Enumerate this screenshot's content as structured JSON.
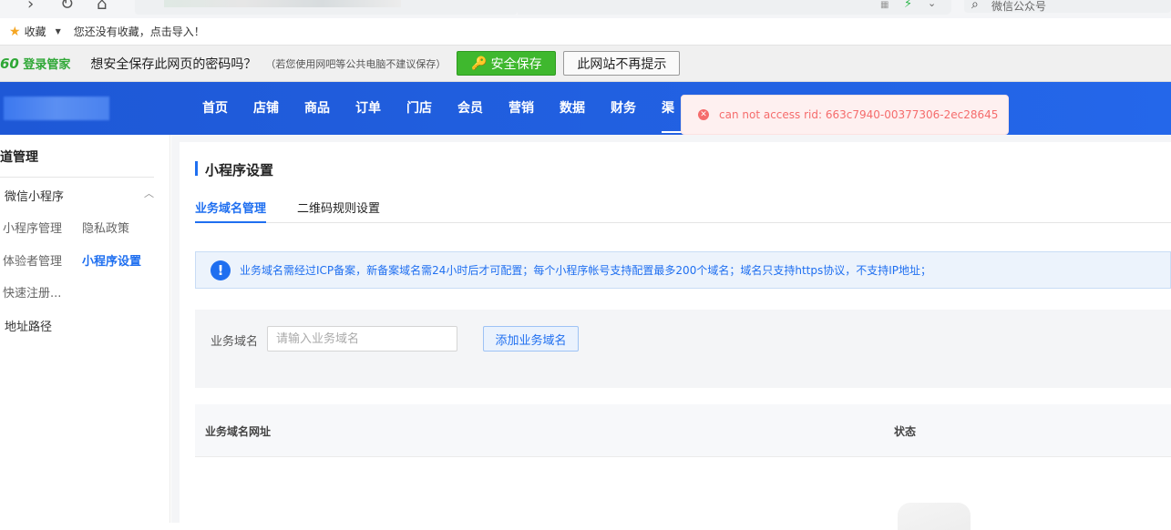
{
  "browser": {
    "back_icon": "back-arrow-icon",
    "reload_icon": "reload-icon",
    "home_icon": "home-icon",
    "search_text": "微信公众号"
  },
  "favorites": {
    "label": "收藏",
    "hint": "您还没有收藏，点击导入！"
  },
  "password_bar": {
    "brand_num": "60",
    "brand_text": "登录管家",
    "question": "想安全保存此网页的密码吗？",
    "note": "（若您使用网吧等公共电脑不建议保存）",
    "save_label": "安全保存",
    "never_label": "此网站不再提示"
  },
  "top_nav": {
    "items": [
      "首页",
      "店铺",
      "商品",
      "订单",
      "门店",
      "会员",
      "营销",
      "数据",
      "财务",
      "渠"
    ]
  },
  "toast": {
    "message": "can not access rid: 663c7940-00377306-2ec28645"
  },
  "sidebar": {
    "section": "道管理",
    "group": "微信小程序",
    "items": {
      "mini_manage": "小程序管理",
      "privacy": "隐私政策",
      "tester": "体验者管理",
      "mini_settings": "小程序设置",
      "quick_register": "快速注册...",
      "address_path": "地址路径"
    }
  },
  "main": {
    "title": "小程序设置",
    "tabs": [
      "业务域名管理",
      "二维码规则设置"
    ],
    "info": "业务域名需经过ICP备案，新备案域名需24小时后才可配置；每个小程序帐号支持配置最多200个域名；域名只支持https协议，不支持IP地址；",
    "form": {
      "label": "业务域名",
      "placeholder": "请输入业务域名",
      "add_button": "添加业务域名"
    },
    "table": {
      "columns": [
        "业务域名网址",
        "状态"
      ]
    }
  },
  "colors": {
    "accent": "#1f6ff0",
    "header": "#1f5fe0",
    "save_green": "#3fb82e",
    "error": "#f56c6c"
  }
}
